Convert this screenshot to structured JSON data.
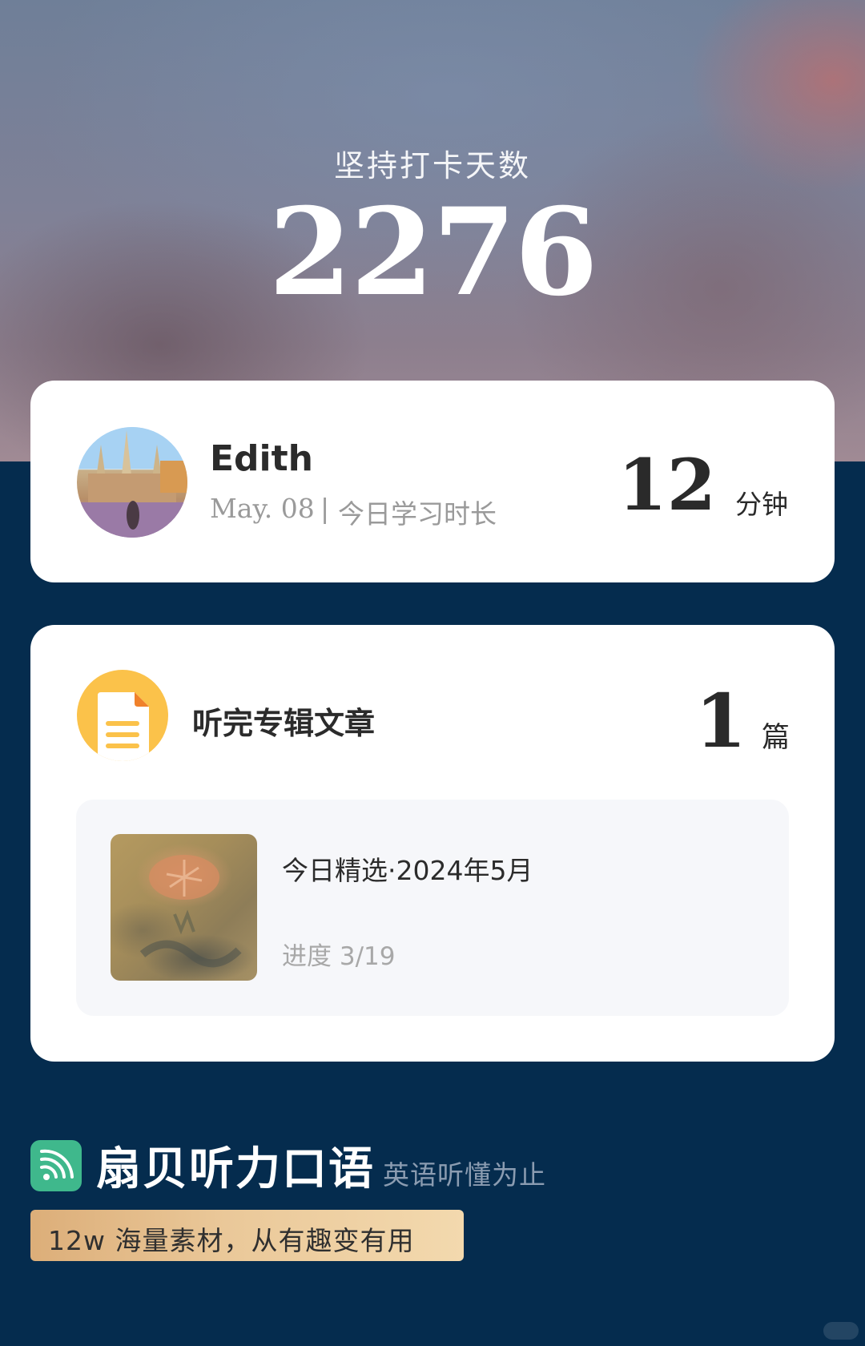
{
  "hero": {
    "title": "坚持打卡天数",
    "days": "2276"
  },
  "user_card": {
    "name": "Edith",
    "date": "May. 08",
    "separator": "|",
    "label": "今日学习时长",
    "minutes": "12",
    "minutes_unit": "分钟"
  },
  "album_card": {
    "title": "听完专辑文章",
    "count": "1",
    "count_unit": "篇",
    "article": {
      "title": "今日精选·2024年5月",
      "progress": "进度 3/19"
    }
  },
  "brand": {
    "name": "扇贝听力口语",
    "slogan": "英语听懂为止",
    "promo": "12w 海量素材，从有趣变有用"
  },
  "colors": {
    "page_bg": "#052c4e",
    "card_bg": "#ffffff",
    "doc_icon": "#fbc24a",
    "brand_icon": "#3fb88c",
    "promo_start": "#dcae79",
    "promo_end": "#f3d9ae"
  },
  "icons": {
    "document": "document-icon",
    "brand": "wifi-signal-icon"
  }
}
